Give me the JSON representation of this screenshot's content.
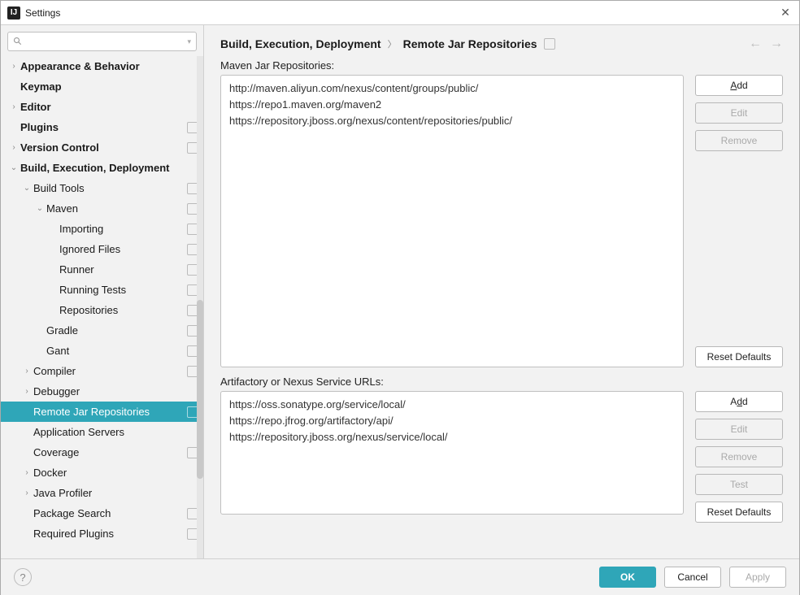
{
  "window": {
    "title": "Settings"
  },
  "search": {
    "placeholder": ""
  },
  "tree": [
    {
      "label": "Appearance & Behavior",
      "indent": 0,
      "arrow": "right",
      "bold": true,
      "icon": false
    },
    {
      "label": "Keymap",
      "indent": 0,
      "arrow": "none",
      "bold": true,
      "icon": false
    },
    {
      "label": "Editor",
      "indent": 0,
      "arrow": "right",
      "bold": true,
      "icon": false
    },
    {
      "label": "Plugins",
      "indent": 0,
      "arrow": "none",
      "bold": true,
      "icon": true
    },
    {
      "label": "Version Control",
      "indent": 0,
      "arrow": "right",
      "bold": true,
      "icon": true
    },
    {
      "label": "Build, Execution, Deployment",
      "indent": 0,
      "arrow": "down",
      "bold": true,
      "icon": false
    },
    {
      "label": "Build Tools",
      "indent": 1,
      "arrow": "down",
      "bold": false,
      "icon": true
    },
    {
      "label": "Maven",
      "indent": 2,
      "arrow": "down",
      "bold": false,
      "icon": true
    },
    {
      "label": "Importing",
      "indent": 3,
      "arrow": "none",
      "bold": false,
      "icon": true
    },
    {
      "label": "Ignored Files",
      "indent": 3,
      "arrow": "none",
      "bold": false,
      "icon": true
    },
    {
      "label": "Runner",
      "indent": 3,
      "arrow": "none",
      "bold": false,
      "icon": true
    },
    {
      "label": "Running Tests",
      "indent": 3,
      "arrow": "none",
      "bold": false,
      "icon": true
    },
    {
      "label": "Repositories",
      "indent": 3,
      "arrow": "none",
      "bold": false,
      "icon": true
    },
    {
      "label": "Gradle",
      "indent": 2,
      "arrow": "none",
      "bold": false,
      "icon": true
    },
    {
      "label": "Gant",
      "indent": 2,
      "arrow": "none",
      "bold": false,
      "icon": true
    },
    {
      "label": "Compiler",
      "indent": 1,
      "arrow": "right",
      "bold": false,
      "icon": true
    },
    {
      "label": "Debugger",
      "indent": 1,
      "arrow": "right",
      "bold": false,
      "icon": false
    },
    {
      "label": "Remote Jar Repositories",
      "indent": 1,
      "arrow": "none",
      "bold": false,
      "icon": true,
      "selected": true
    },
    {
      "label": "Application Servers",
      "indent": 1,
      "arrow": "none",
      "bold": false,
      "icon": false
    },
    {
      "label": "Coverage",
      "indent": 1,
      "arrow": "none",
      "bold": false,
      "icon": true
    },
    {
      "label": "Docker",
      "indent": 1,
      "arrow": "right",
      "bold": false,
      "icon": false
    },
    {
      "label": "Java Profiler",
      "indent": 1,
      "arrow": "right",
      "bold": false,
      "icon": false
    },
    {
      "label": "Package Search",
      "indent": 1,
      "arrow": "none",
      "bold": false,
      "icon": true
    },
    {
      "label": "Required Plugins",
      "indent": 1,
      "arrow": "none",
      "bold": false,
      "icon": true
    }
  ],
  "breadcrumb": {
    "parent": "Build, Execution, Deployment",
    "current": "Remote Jar Repositories"
  },
  "maven": {
    "label": "Maven Jar Repositories:",
    "items": [
      "http://maven.aliyun.com/nexus/content/groups/public/",
      "https://repo1.maven.org/maven2",
      "https://repository.jboss.org/nexus/content/repositories/public/"
    ]
  },
  "artifactory": {
    "label": "Artifactory or Nexus Service URLs:",
    "items": [
      "https://oss.sonatype.org/service/local/",
      "https://repo.jfrog.org/artifactory/api/",
      "https://repository.jboss.org/nexus/service/local/"
    ]
  },
  "buttons": {
    "add": "Add",
    "edit": "Edit",
    "remove": "Remove",
    "test": "Test",
    "reset": "Reset Defaults",
    "ok": "OK",
    "cancel": "Cancel",
    "apply": "Apply"
  }
}
